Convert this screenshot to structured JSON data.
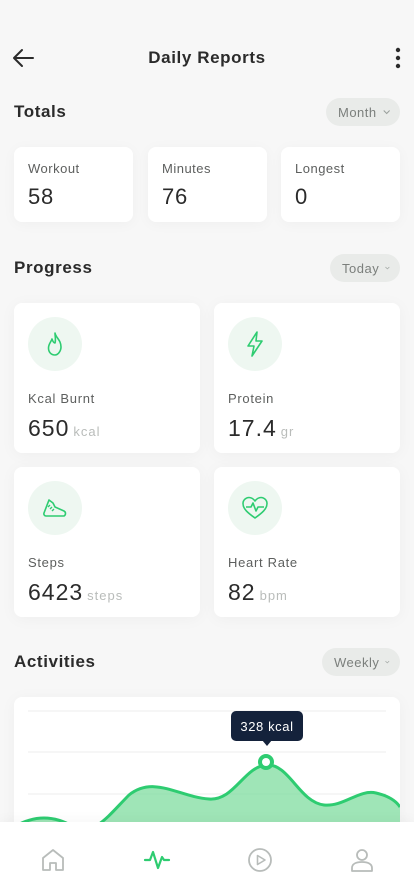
{
  "header": {
    "title": "Daily Reports"
  },
  "totals": {
    "title": "Totals",
    "period": "Month",
    "cards": [
      {
        "label": "Workout",
        "value": "58"
      },
      {
        "label": "Minutes",
        "value": "76"
      },
      {
        "label": "Longest",
        "value": "0"
      }
    ]
  },
  "progress": {
    "title": "Progress",
    "period": "Today",
    "cards": [
      {
        "label": "Kcal Burnt",
        "value": "650",
        "unit": "kcal",
        "icon": "flame-icon"
      },
      {
        "label": "Protein",
        "value": "17.4",
        "unit": "gr",
        "icon": "lightning-icon"
      },
      {
        "label": "Steps",
        "value": "6423",
        "unit": "steps",
        "icon": "shoe-icon"
      },
      {
        "label": "Heart Rate",
        "value": "82",
        "unit": "bpm",
        "icon": "heart-rate-icon"
      }
    ]
  },
  "activities": {
    "title": "Activities",
    "period": "Weekly",
    "tooltip": "328 kcal"
  },
  "colors": {
    "accent": "#2ecc71",
    "accent_fill": "#7fdc9f",
    "tooltip_bg": "#14223b",
    "pill_bg": "#e9ebe9"
  },
  "tabbar": {
    "items": [
      {
        "icon": "home-icon",
        "active": false
      },
      {
        "icon": "activity-icon",
        "active": true
      },
      {
        "icon": "play-icon",
        "active": false
      },
      {
        "icon": "profile-icon",
        "active": false
      }
    ]
  }
}
